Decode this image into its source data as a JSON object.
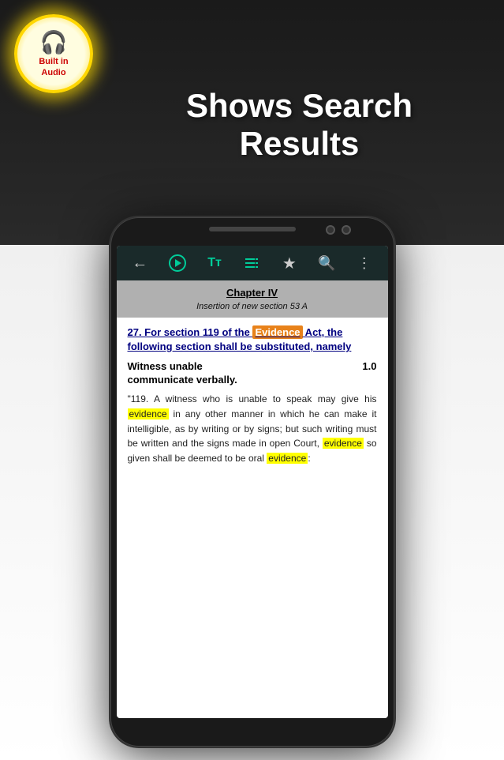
{
  "background": {
    "top_color": "#1a1a1a",
    "bottom_color": "#ffffff"
  },
  "badge": {
    "icon": "🎧",
    "line1": "Built in",
    "line2": "Audio"
  },
  "header": {
    "title_line1": "Shows Search",
    "title_line2": "Results"
  },
  "toolbar": {
    "back_icon": "←",
    "play_icon": "▶",
    "text_size_icon": "Tт",
    "list_icon": "☰",
    "star_icon": "★",
    "search_icon": "🔍",
    "more_icon": "⋮"
  },
  "chapter": {
    "title": "Chapter IV",
    "subtitle": "Insertion of new section 53 A"
  },
  "section": {
    "heading": "27. For section 119 of the Evidence Act, the following section shall be substituted, namely",
    "highlighted_word": "Evidence",
    "witness_title": "Witness unable",
    "witness_number": "1.0",
    "witness_subtitle": "communicate verbally.",
    "body_text": "“119. A witness who is unable to speak may give his evidence in any other manner in which he can make it intelligible, as by writing or by signs; but such writing must be written and the signs made in open Court, evidence so given shall be deemed to be oral evidence:",
    "highlighted_words": [
      "evidence",
      "evidence",
      "evidence"
    ]
  }
}
